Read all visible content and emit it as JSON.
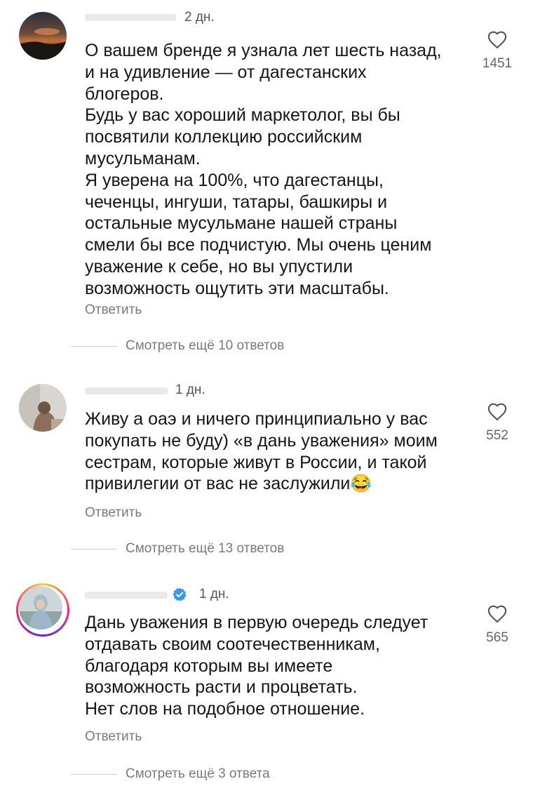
{
  "comments": [
    {
      "time": "2 дн.",
      "lines": [
        "О вашем бренде я узнала лет шесть назад,",
        "и на удивление — от дагестанских",
        "блогеров.",
        "Будь у вас хороший маркетолог, вы бы",
        "посвятили коллекцию российским",
        "мусульманам.",
        "Я уверена на 100%, что дагестанцы,",
        "чеченцы, ингуши, татары, башкиры и",
        "остальные мусульмане нашей страны",
        "смели бы все подчистую. Мы очень ценим",
        "уважение к себе, но вы упустили",
        "возможность ощутить эти масштабы."
      ],
      "reply_label": "Ответить",
      "more_replies": "Смотреть ещё 10 ответов",
      "likes": "1451",
      "like_icon": "heart-icon"
    },
    {
      "time": "1 дн.",
      "lines": [
        "Живу а оаэ и ничего принципиально у вас",
        "покупать не буду) «в дань уважения» моим",
        "сестрам, которые живут в России, и такой",
        "привилегии от вас не заслужили😂"
      ],
      "reply_label": "Ответить",
      "more_replies": "Смотреть ещё 13 ответов",
      "likes": "552",
      "like_icon": "heart-icon"
    },
    {
      "time": "1 дн.",
      "verified": true,
      "lines": [
        "Дань уважения в первую очередь следует",
        "отдавать своим соотечественникам,",
        "благодаря которым вы имеете",
        "возможность расти и процветать.",
        "Нет слов на подобное отношение."
      ],
      "reply_label": "Ответить",
      "more_replies": "Смотреть ещё 3 ответа",
      "likes": "565",
      "like_icon": "heart-icon"
    }
  ],
  "colors": {
    "text": "#161616",
    "secondary": "#7a7a7a",
    "verified_badge": "#3897f0",
    "story_ring": [
      "#f9ce34",
      "#ee2a7b",
      "#6228d7"
    ]
  }
}
